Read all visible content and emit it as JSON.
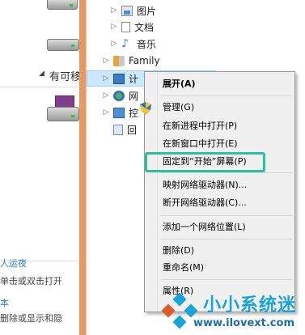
{
  "left_pane": {
    "removable_label": "有可移",
    "link_1": "人运夜",
    "hint_click": "单击或双击打开",
    "link_2": "本",
    "hint_delete": "删除或显示和隐"
  },
  "tree": {
    "items": [
      {
        "label": "图片",
        "icon": "pictures-folder-icon",
        "expander": "▷"
      },
      {
        "label": "文档",
        "icon": "documents-folder-icon",
        "expander": "▷"
      },
      {
        "label": "音乐",
        "icon": "music-folder-icon",
        "expander": "▷"
      },
      {
        "label": "Family",
        "icon": "homegroup-user-icon",
        "expander": "▷"
      },
      {
        "label": "计",
        "icon": "computer-icon",
        "expander": "▷"
      },
      {
        "label": "网",
        "icon": "network-icon",
        "expander": "▷"
      },
      {
        "label": "控",
        "icon": "control-panel-icon",
        "expander": "▷"
      },
      {
        "label": "回",
        "icon": "recycle-bin-icon",
        "expander": ""
      }
    ]
  },
  "context_menu": {
    "expand": "展开(A)",
    "manage": "管理(G)",
    "open_new_process": "在新进程中打开(P)",
    "open_new_window": "在新窗口中打开(E)",
    "pin_to_start": "固定到“开始”屏幕(P)",
    "map_drive": "映射网络驱动器(N)...",
    "disconnect_drive": "断开网络驱动器(C)...",
    "add_network_location": "添加一个网络位置(L)",
    "delete": "删除(D)",
    "rename": "重命名(M)",
    "properties": "属性(R)"
  },
  "watermark": {
    "title": "小小系统迷",
    "url": "www.ilovext.com"
  },
  "colors": {
    "divider": "#e59a63",
    "highlight": "#2bbf9a",
    "selection": "#cce8ff",
    "watermark": "#1aa3d9"
  }
}
